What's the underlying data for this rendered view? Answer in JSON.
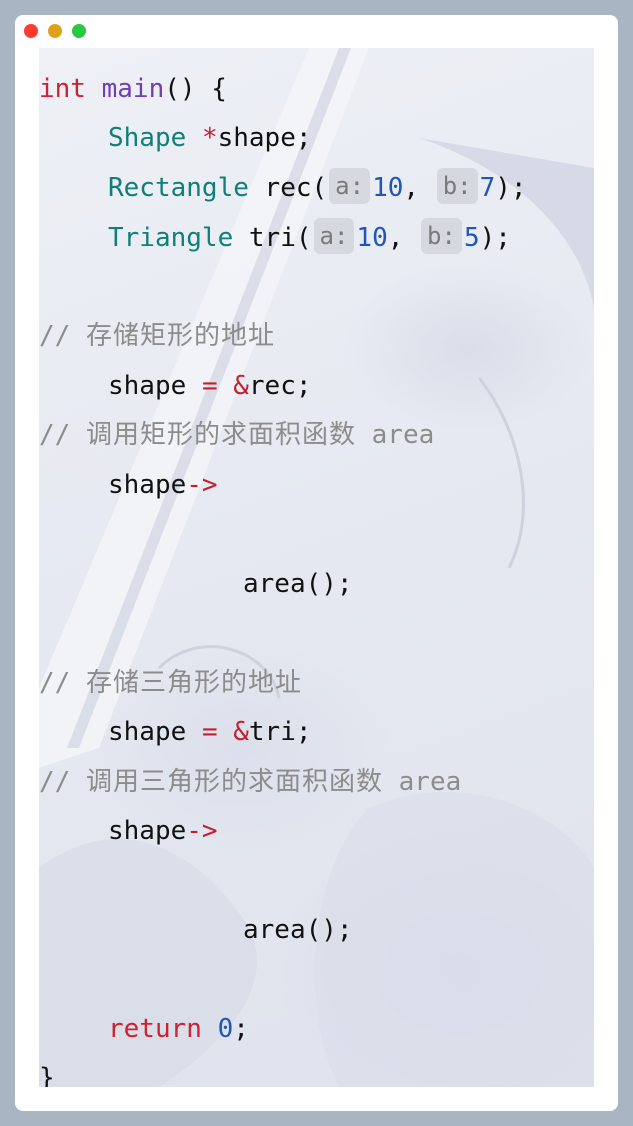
{
  "window": {
    "controls": [
      "close",
      "minimize",
      "maximize"
    ],
    "colors": {
      "close": "#ff3b30",
      "minimize": "#e0a11a",
      "maximize": "#28c840"
    }
  },
  "code": {
    "l1": {
      "kw": "int",
      "fn": "main",
      "rest": "() {"
    },
    "l2": {
      "type": "Shape",
      "op": "*",
      "rest": "shape;"
    },
    "l3": {
      "type": "Rectangle",
      "call": "rec(",
      "hint_a": "a:",
      "val_a": "10",
      "comma": ",",
      "hint_b": "b:",
      "val_b": "7",
      "end": ");"
    },
    "l4": {
      "type": "Triangle",
      "call": "tri(",
      "hint_a": "a:",
      "val_a": "10",
      "comma": ",",
      "hint_b": "b:",
      "val_b": "5",
      "end": ");"
    },
    "c1": {
      "slashes": "//",
      "text": "存储矩形的地址"
    },
    "l5": {
      "lhs": "shape",
      "eq": "=",
      "amp": "&",
      "rest": "rec;"
    },
    "c2": {
      "slashes": "//",
      "text": "调用矩形的求面积函数",
      "tail": "area"
    },
    "l6": {
      "lhs": "shape",
      "arrow": "->"
    },
    "l7": {
      "rest": "area();"
    },
    "c3": {
      "slashes": "//",
      "text": "存储三角形的地址"
    },
    "l8": {
      "lhs": "shape",
      "eq": "=",
      "amp": "&",
      "rest": "tri;"
    },
    "c4": {
      "slashes": "//",
      "text": "调用三角形的求面积函数",
      "tail": "area"
    },
    "l9": {
      "lhs": "shape",
      "arrow": "->"
    },
    "l10": {
      "rest": "area();"
    },
    "l11": {
      "kw": "return",
      "num": "0",
      "rest": ";"
    },
    "l12": {
      "rest": "}"
    }
  }
}
